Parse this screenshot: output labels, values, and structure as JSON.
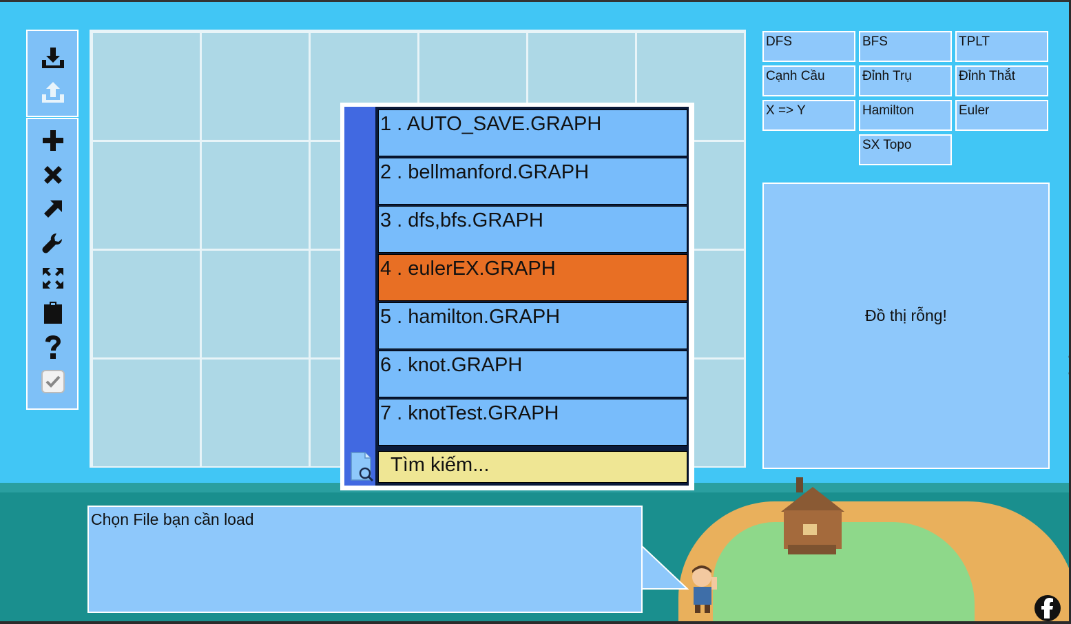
{
  "toolbar": {
    "file_tools": [
      "download-icon",
      "upload-icon"
    ],
    "edit_tools": [
      "plus-icon",
      "close-icon",
      "arrow-icon",
      "wrench-icon",
      "expand-icon",
      "clipboard-icon",
      "question-icon",
      "check-icon"
    ]
  },
  "algorithms": {
    "buttons": [
      "DFS",
      "BFS",
      "TPLT",
      "Cạnh Cầu",
      "Đỉnh Trụ",
      "Đỉnh Thắt",
      "X => Y",
      "Hamilton",
      "Euler",
      "SX Topo"
    ]
  },
  "result_panel": {
    "text": "Đồ thị rỗng!"
  },
  "file_dialog": {
    "files": [
      "1 . AUTO_SAVE.GRAPH",
      "2 . bellmanford.GRAPH",
      "3 . dfs,bfs.GRAPH",
      "4 . eulerEX.GRAPH",
      "5 . hamilton.GRAPH",
      "6 . knot.GRAPH",
      "7 . knotTest.GRAPH"
    ],
    "selected_index": 3,
    "search_placeholder": "Tìm kiếm..."
  },
  "message": {
    "text": "Chọn File bạn cần load"
  },
  "colors": {
    "background": "#41c6f5",
    "panel": "#8ec8fb",
    "file_item": "#78bcfb",
    "selected": "#e86f24",
    "search": "#efe694",
    "dialog_sidebar": "#4169e1"
  },
  "icons": {
    "social": "facebook-icon"
  }
}
